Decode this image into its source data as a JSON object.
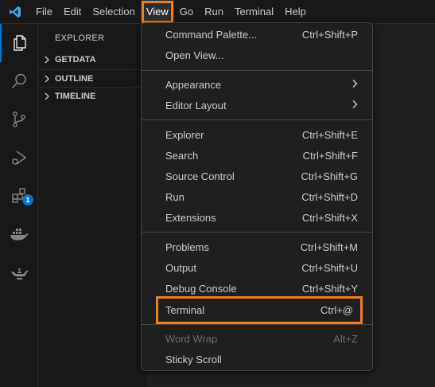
{
  "menubar": {
    "items": [
      "File",
      "Edit",
      "Selection",
      "View",
      "Go",
      "Run",
      "Terminal",
      "Help"
    ],
    "active": "View"
  },
  "activity_bar": {
    "items": [
      "explorer-icon",
      "search-icon",
      "source-control-icon",
      "run-debug-icon",
      "extensions-icon",
      "docker-icon",
      "genie-lamp-icon"
    ],
    "extensions_badge": "1"
  },
  "sidebar": {
    "title": "EXPLORER",
    "sections": [
      "GETDATA",
      "OUTLINE",
      "TIMELINE"
    ]
  },
  "view_menu": {
    "groups": [
      [
        {
          "label": "Command Palette...",
          "shortcut": "Ctrl+Shift+P"
        },
        {
          "label": "Open View...",
          "shortcut": ""
        }
      ],
      [
        {
          "label": "Appearance",
          "shortcut": ""
        },
        {
          "label": "Editor Layout",
          "shortcut": ""
        }
      ],
      [
        {
          "label": "Explorer",
          "shortcut": "Ctrl+Shift+E"
        },
        {
          "label": "Search",
          "shortcut": "Ctrl+Shift+F"
        },
        {
          "label": "Source Control",
          "shortcut": "Ctrl+Shift+G"
        },
        {
          "label": "Run",
          "shortcut": "Ctrl+Shift+D"
        },
        {
          "label": "Extensions",
          "shortcut": "Ctrl+Shift+X"
        }
      ],
      [
        {
          "label": "Problems",
          "shortcut": "Ctrl+Shift+M"
        },
        {
          "label": "Output",
          "shortcut": "Ctrl+Shift+U"
        },
        {
          "label": "Debug Console",
          "shortcut": "Ctrl+Shift+Y"
        },
        {
          "label": "Terminal",
          "shortcut": "Ctrl+@"
        }
      ],
      [
        {
          "label": "Word Wrap",
          "shortcut": "Alt+Z"
        },
        {
          "label": "Sticky Scroll",
          "shortcut": ""
        }
      ]
    ],
    "highlighted_item": "Terminal",
    "disabled_item": "Word Wrap"
  },
  "colors": {
    "highlight": "#f07f1e",
    "accent": "#0078d4",
    "background": "#1f1f1f"
  }
}
